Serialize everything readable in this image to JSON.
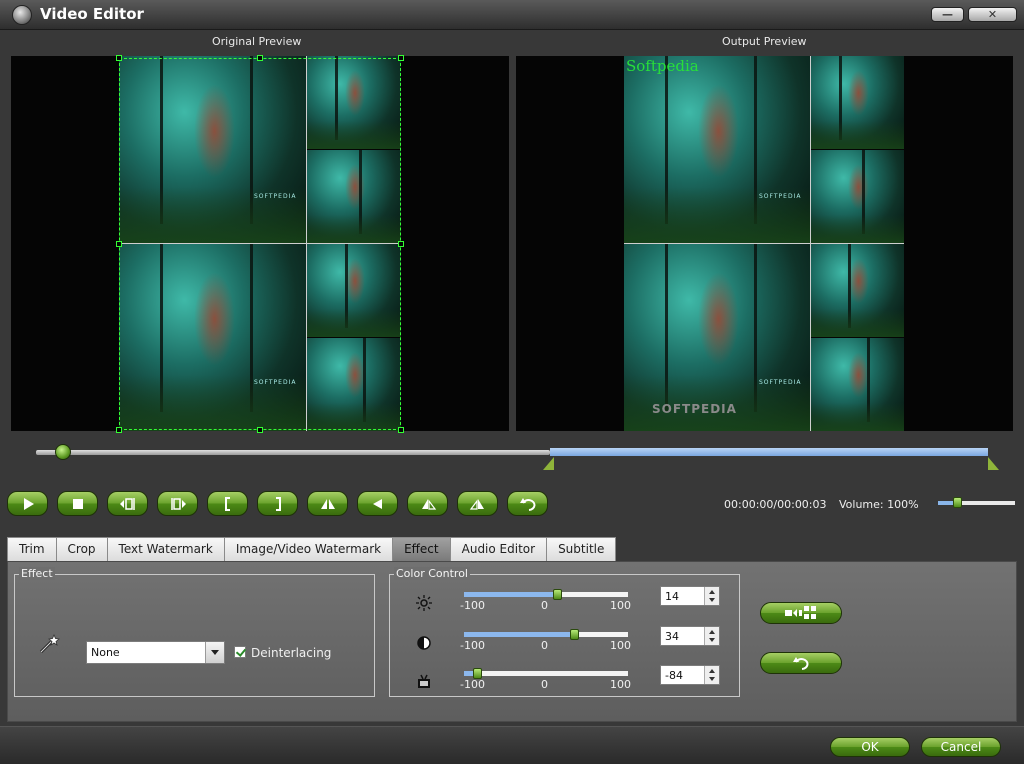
{
  "window": {
    "title": "Video Editor",
    "minimize_glyph": "—",
    "close_glyph": "✕"
  },
  "previews": {
    "original_label": "Original Preview",
    "output_label": "Output Preview",
    "output_watermark_text": "Softpedia",
    "output_logo_text": "SOFTPEDIA",
    "frame_caption": "SOFTPEDIA"
  },
  "timeline": {
    "position": 0.02,
    "in_point": 0.54,
    "out_point": 1.0,
    "in_marker_color": "#8fb43a"
  },
  "transport": {
    "buttons": [
      {
        "name": "play-button",
        "icon": "play-icon"
      },
      {
        "name": "stop-button",
        "icon": "stop-icon"
      },
      {
        "name": "prev-frame-button",
        "icon": "prev-frame-icon"
      },
      {
        "name": "next-frame-button",
        "icon": "next-frame-icon"
      },
      {
        "name": "mark-in-button",
        "icon": "bracket-left-icon"
      },
      {
        "name": "mark-out-button",
        "icon": "bracket-right-icon"
      },
      {
        "name": "flip-horizontal-button",
        "icon": "flip-horizontal-icon"
      },
      {
        "name": "flip-vertical-button",
        "icon": "flip-vertical-icon"
      },
      {
        "name": "rotate-left-button",
        "icon": "rotate-left-icon"
      },
      {
        "name": "rotate-right-button",
        "icon": "rotate-right-icon"
      },
      {
        "name": "reset-button",
        "icon": "undo-icon"
      }
    ],
    "time": "00:00:00/00:00:03",
    "volume_label": "Volume:",
    "volume_value": "100%",
    "volume_level": 0.25
  },
  "tabs": [
    "Trim",
    "Crop",
    "Text Watermark",
    "Image/Video Watermark",
    "Effect",
    "Audio Editor",
    "Subtitle"
  ],
  "active_tab": "Effect",
  "effect": {
    "group_title": "Effect",
    "selected": "None",
    "deinterlacing_label": "Deinterlacing",
    "deinterlacing_checked": true
  },
  "color_control": {
    "group_title": "Color Control",
    "rows": [
      {
        "name": "brightness",
        "icon": "brightness-icon",
        "min": "-100",
        "mid": "0",
        "max": "100",
        "value": "14",
        "level": 14
      },
      {
        "name": "contrast",
        "icon": "contrast-icon",
        "min": "-100",
        "mid": "0",
        "max": "100",
        "value": "34",
        "level": 34
      },
      {
        "name": "saturation",
        "icon": "saturation-icon",
        "min": "-100",
        "mid": "0",
        "max": "100",
        "value": "-84",
        "level": -84
      }
    ]
  },
  "side_buttons": [
    {
      "name": "apply-to-all-button",
      "icon": "apply-all-icon"
    },
    {
      "name": "reset-effects-button",
      "icon": "undo-icon"
    }
  ],
  "footer": {
    "ok": "OK",
    "cancel": "Cancel"
  },
  "colors": {
    "accent_green": "#6aa22c",
    "crop_dashed": "#33ff33",
    "watermark_green": "#27e03a",
    "timeline_blue": "#8ab6ea"
  }
}
